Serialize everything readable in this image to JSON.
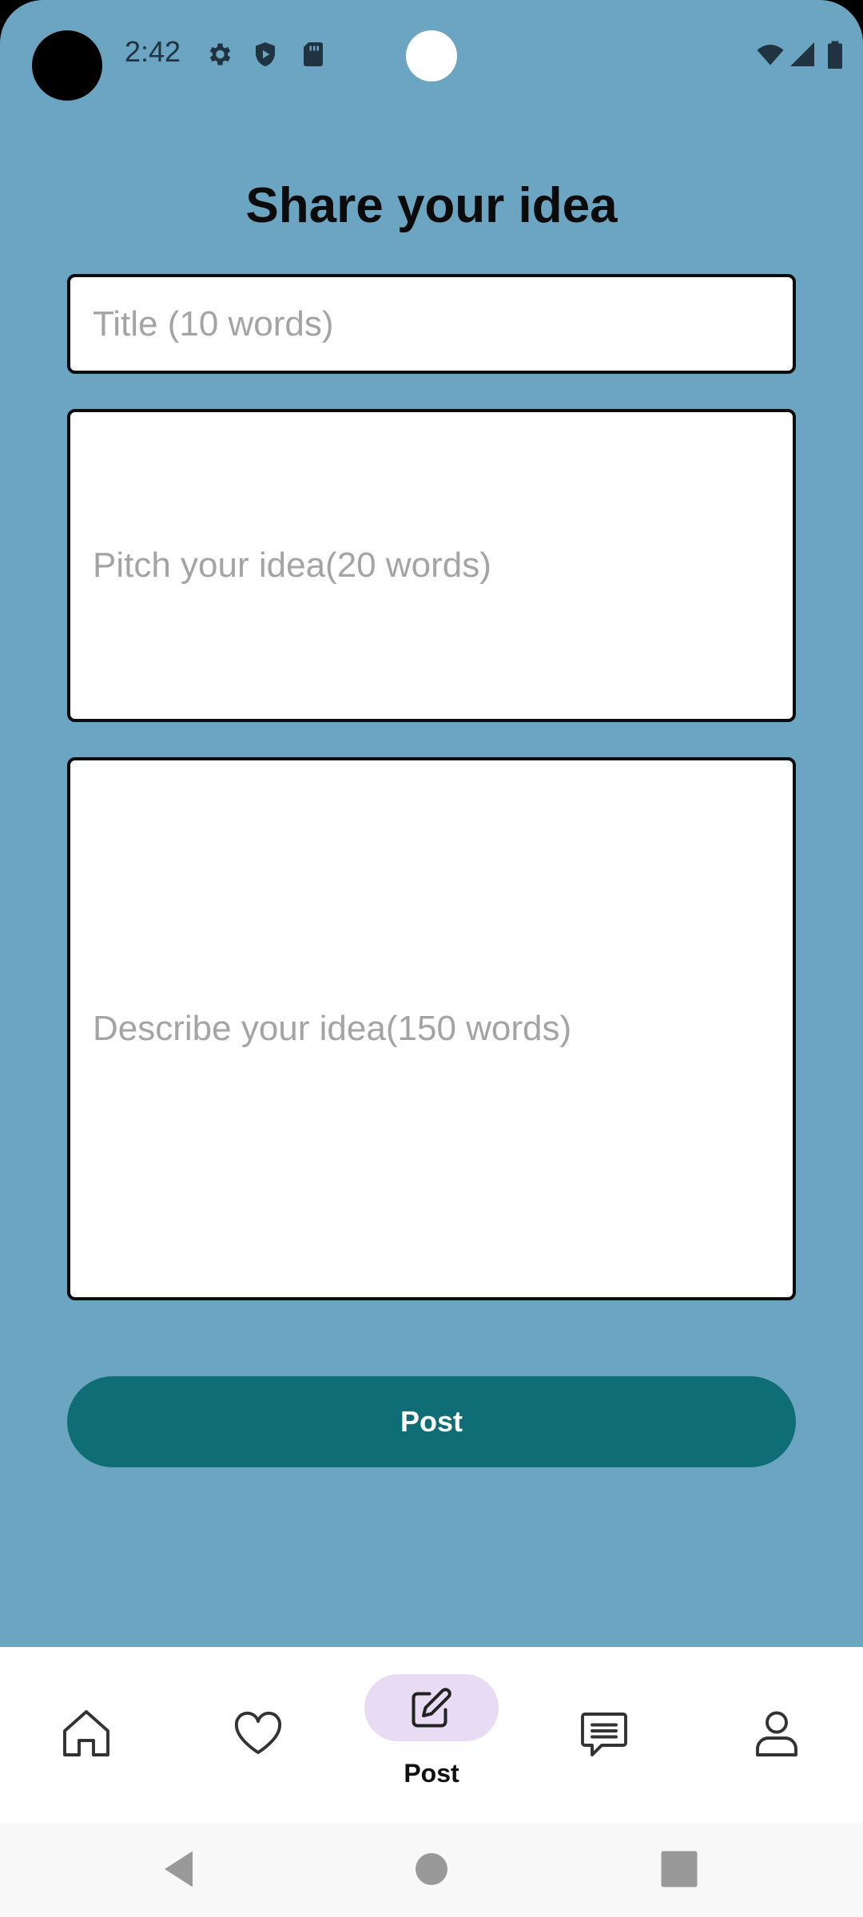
{
  "status_bar": {
    "time": "2:42",
    "icons": [
      "settings-icon",
      "shield-play-icon",
      "sd-card-icon",
      "wifi-icon",
      "signal-icon",
      "battery-icon"
    ]
  },
  "page": {
    "title": "Share your idea"
  },
  "form": {
    "title_placeholder": "Title (10 words)",
    "pitch_placeholder": "Pitch your idea(20 words)",
    "description_placeholder": "Describe your idea(150 words)",
    "post_label": "Post"
  },
  "bottom_nav": {
    "items": [
      {
        "icon": "home-icon"
      },
      {
        "icon": "heart-icon"
      },
      {
        "icon": "edit-icon",
        "label": "Post",
        "active": true
      },
      {
        "icon": "chat-icon"
      },
      {
        "icon": "profile-icon"
      }
    ]
  },
  "colors": {
    "background": "#6ca5c2",
    "accent": "#0f6e75",
    "active_pill": "#e7dcf4"
  }
}
